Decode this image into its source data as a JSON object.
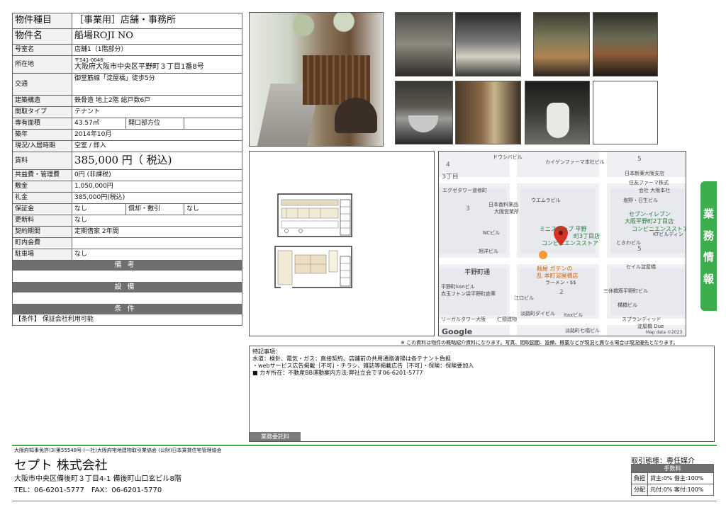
{
  "property": {
    "type_label": "物件種目",
    "type_value": "［事業用］店舗・事務所",
    "name_label": "物件名",
    "name_value": "船場ROJI NO",
    "room_label": "号室名",
    "room_value": "店舗1（1階部分）",
    "address_label": "所在地",
    "zip": "〒541-0046",
    "address": "大阪府大阪市中央区平野町３丁目1番8号",
    "access_label": "交通",
    "access_value": "御堂筋線「淀屋橋」徒歩5分",
    "structure_label": "建築構造",
    "structure_value": "鉄骨造 地上2階 総戸数6戸",
    "layout_label": "間取タイプ",
    "layout_value": "テナント",
    "area_label": "専有面積",
    "area_value": "43.57㎡",
    "opening_label": "開口部方位",
    "opening_value": "",
    "built_label": "築年",
    "built_value": "2014年10月",
    "status_label": "現況/入居時期",
    "status_value": "空室 / 即入",
    "rent_label": "賃料",
    "rent_value": "385,000 円（ 税込)",
    "common_label": "共益費・管理費",
    "common_value": "0円 (非課税)",
    "deposit_label": "敷金",
    "deposit_value": "1,050,000円",
    "key_money_label": "礼金",
    "key_money_value": "385,000円(税込)",
    "guarantee_label": "保証金",
    "guarantee_value": "なし",
    "amort_label": "償却・敷引",
    "amort_value": "なし",
    "renewal_label": "更新料",
    "renewal_value": "なし",
    "contract_label": "契約期間",
    "contract_value": "定期借家 2年間",
    "town_fee_label": "町内会費",
    "town_fee_value": "",
    "parking_label": "駐車場",
    "parking_value": "なし",
    "remarks_bar": "備考",
    "facilities_bar": "設備",
    "conditions_bar": "条件",
    "conditions_text": "【条件】 保証会社利用可能"
  },
  "side_tab": [
    "業",
    "務",
    "情",
    "報"
  ],
  "map": {
    "labels": [
      "ドウシバビル",
      "カイゲンファーマ本社ビル",
      "日本新薬大阪支店",
      "住友ファーマ株式",
      "会社 大阪本社",
      "エグゼタワー道修町",
      "ウエムラビル",
      "塩野・日生ビル",
      "日本香料薬品",
      "大阪営業所",
      "セブン-イレブン",
      "大阪平野町2丁目店",
      "コンビニエンスストア",
      "KTビルディン",
      "NCビル",
      "ミニストップ 平野",
      "町3丁目店",
      "コンビニエンスストア",
      "ときわビル",
      "旭洋ビル",
      "麺屋 ガテンの",
      "乱 本町淀屋橋店",
      "ラーメン・$$",
      "セイル淀屋橋",
      "平野町通",
      "平野町kanビル",
      "赤玉フトン袋平野町倉庫",
      "江口ビル",
      "三休橋筋平野町ビル",
      "リーガルタワー大阪",
      "淡路町ダイビル",
      "itaxビル",
      "構橋ビル",
      "仁德建物",
      "スプランディッド",
      "淀屋橋 Due",
      "淡路町七福ビル",
      "Google",
      "Map data ©2023"
    ],
    "numbers": [
      "4",
      "3丁目",
      "3",
      "5",
      "5",
      "2"
    ]
  },
  "disclaimer": "※ この資料は物件の概略紹介資料になります。写真、間取図面、設備、概要などが現況と異なる場合は現況優先となります。",
  "notes": {
    "heading": "特記事項：",
    "lines": [
      "水道：検針、電気・ガス：直接契約、店舗前の共用通路清掃は各テナント負担",
      "・webサービス広告掲載［不可］・チラシ、雑誌等掲載広告［不可］・保険：保険要加入",
      "■ カギ所在：不動産BB運動案内方法:弊社立会です06-6201-5777"
    ],
    "broker_box": "業務委託料"
  },
  "footer": {
    "license": "大阪府知事免許(3)第55548号 (一社)大阪府宅地建物取引業協会 (公財)日本賃貸住宅管理協会",
    "company": "セプト 株式会社",
    "address": "大阪市中央区備後町３丁目4-1 備後町山口玄ビル8階",
    "tel": "TEL：06-6201-5777　FAX：06-6201-5770",
    "deal": "取引態様：専任媒介",
    "fee_header": "手数料",
    "fee_rows": [
      {
        "k": "負担",
        "v": "貸主:0% 借主:100%"
      },
      {
        "k": "分配",
        "v": "元付:0% 客付:100%"
      }
    ]
  }
}
